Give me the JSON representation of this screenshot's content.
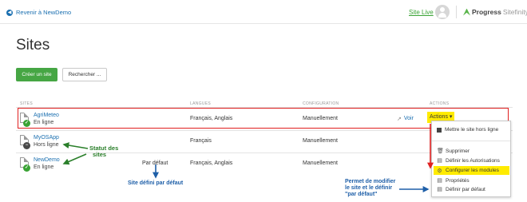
{
  "topbar": {
    "back_label": "Revenir à NewDemo",
    "site_live": "Site Live",
    "logo_bold": "Progress",
    "logo_light": "Sitefinity"
  },
  "page": {
    "title": "Sites",
    "create_button": "Créer un site",
    "search_button": "Rechercher ..."
  },
  "table": {
    "headers": [
      "SITES",
      "LANGUES",
      "CONFIGURATION",
      "ACTIONS"
    ],
    "rows": [
      {
        "name": "AgriMeteo",
        "status": "En ligne",
        "languages": "Français, Anglais",
        "config": "Manuellement",
        "view": "Voir",
        "actions": "Actions ▾",
        "default": ""
      },
      {
        "name": "MyOSApp",
        "status": "Hors ligne",
        "languages": "Français",
        "config": "Manuellement",
        "view": "",
        "actions": "",
        "default": ""
      },
      {
        "name": "NewDemo",
        "status": "En ligne",
        "languages": "Français, Anglais",
        "config": "Manuellement",
        "view": "",
        "actions": "",
        "default": "Par défaut"
      }
    ]
  },
  "menu": {
    "items": [
      {
        "label": "Mettre le site hors ligne",
        "icon": "square-icon"
      },
      {
        "label": "Supprimer",
        "icon": "trash-icon"
      },
      {
        "label": "Définir les Autorisations",
        "icon": "document-icon"
      },
      {
        "label": "Configurer les modules",
        "icon": "gear-icon"
      },
      {
        "label": "Propriétés",
        "icon": "document-icon"
      },
      {
        "label": "Définir par défaut",
        "icon": "document-icon"
      }
    ]
  },
  "annotations": {
    "statut": "Statut des sites",
    "statut_1": "Statut des",
    "statut_2": "sites",
    "default_site": "Site défini par défaut",
    "modify_1": "Permet de modifier",
    "modify_2": "le site et le définir",
    "modify_3": "\"par défaut\""
  },
  "colors": {
    "accent_green": "#46a644",
    "link_blue": "#1a6fb0",
    "highlight_yellow": "#ffeb00",
    "callout_red": "#e02020",
    "annotation_green": "#2a7f2a",
    "annotation_blue": "#1e5fa8"
  }
}
